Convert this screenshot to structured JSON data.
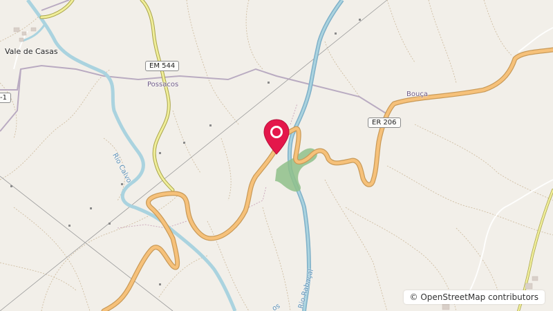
{
  "map": {
    "colors": {
      "background": "#f2efe9",
      "river": "#aad3df",
      "major_river": "#7fb0c8",
      "road_secondary": "#f6c17a",
      "road_tertiary": "#f0ee9a",
      "road_casing": "#c99a58",
      "boundary": "#b3a3bd",
      "track": "#b59b72",
      "forest": "#8fc08a",
      "marker": "#e4174b"
    },
    "labels": {
      "town_vale_de_casas": "Vale de Casas",
      "locality_possacos": "Possacos",
      "locality_bouca": "Bouça",
      "river_rio_calvo": "Rio Calvo",
      "river_rio_rabacal": "Rio Rabaçal",
      "partial_label_left": "-1",
      "partial_label_bottom": "os"
    },
    "road_refs": {
      "em544": "EM 544",
      "er206": "ER 206"
    },
    "marker_icon": "map-pin-icon",
    "attribution": "© OpenStreetMap contributors"
  }
}
